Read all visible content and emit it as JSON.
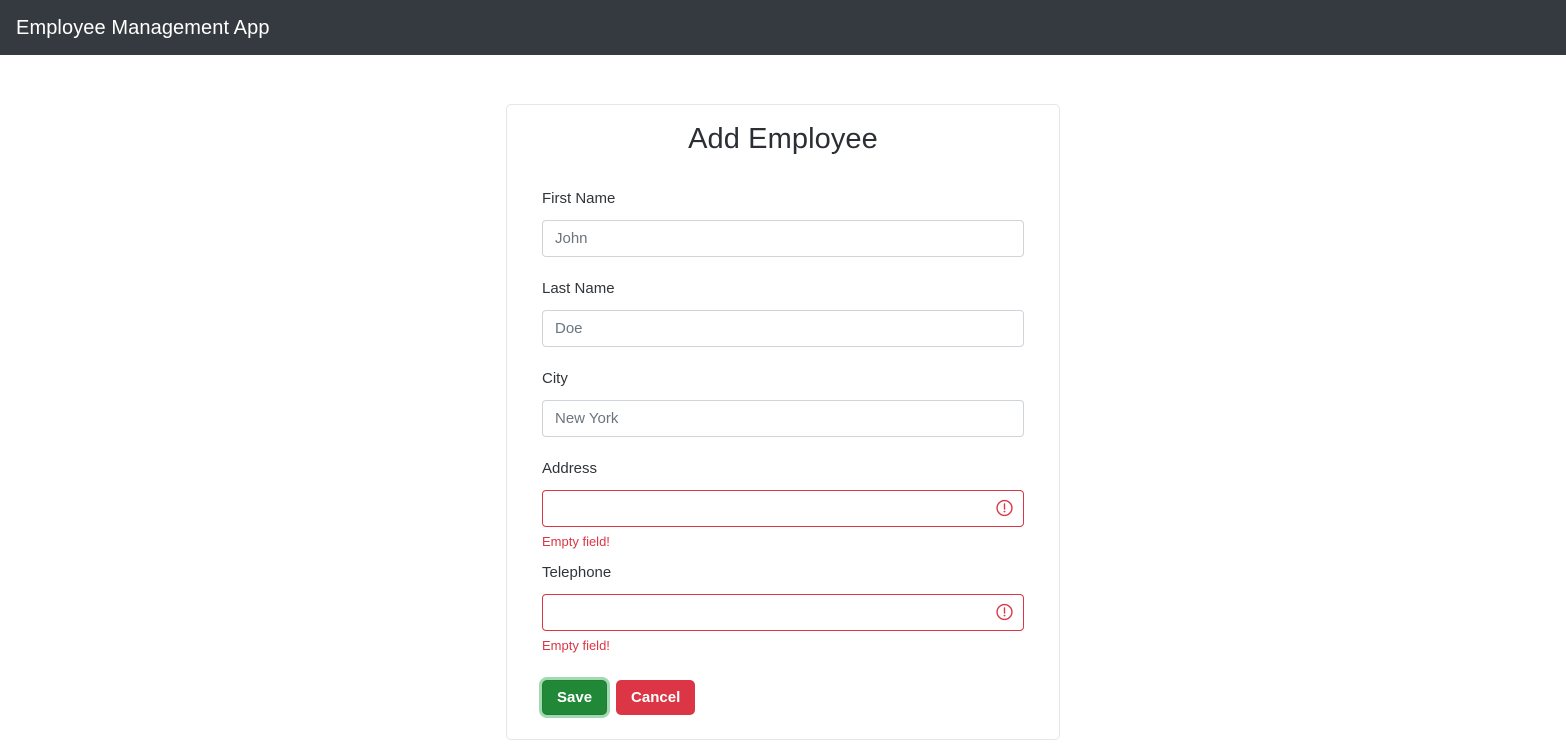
{
  "navbar": {
    "brand": "Employee Management App"
  },
  "card": {
    "title": "Add Employee",
    "fields": [
      {
        "label": "First Name",
        "value": "",
        "placeholder": "John",
        "invalid": false,
        "error": ""
      },
      {
        "label": "Last Name",
        "value": "",
        "placeholder": "Doe",
        "invalid": false,
        "error": ""
      },
      {
        "label": "City",
        "value": "",
        "placeholder": "New York",
        "invalid": false,
        "error": ""
      },
      {
        "label": "Address",
        "value": "",
        "placeholder": "",
        "invalid": true,
        "error": "Empty field!"
      },
      {
        "label": "Telephone",
        "value": "",
        "placeholder": "",
        "invalid": true,
        "error": "Empty field!"
      }
    ],
    "buttons": {
      "save": "Save",
      "cancel": "Cancel"
    }
  },
  "icons": {
    "invalid": "exclamation-circle-icon"
  },
  "colors": {
    "navbar_bg": "#343a40",
    "danger": "#dc3545",
    "success": "#218838",
    "border": "#ced4da",
    "placeholder": "#6c757d"
  }
}
